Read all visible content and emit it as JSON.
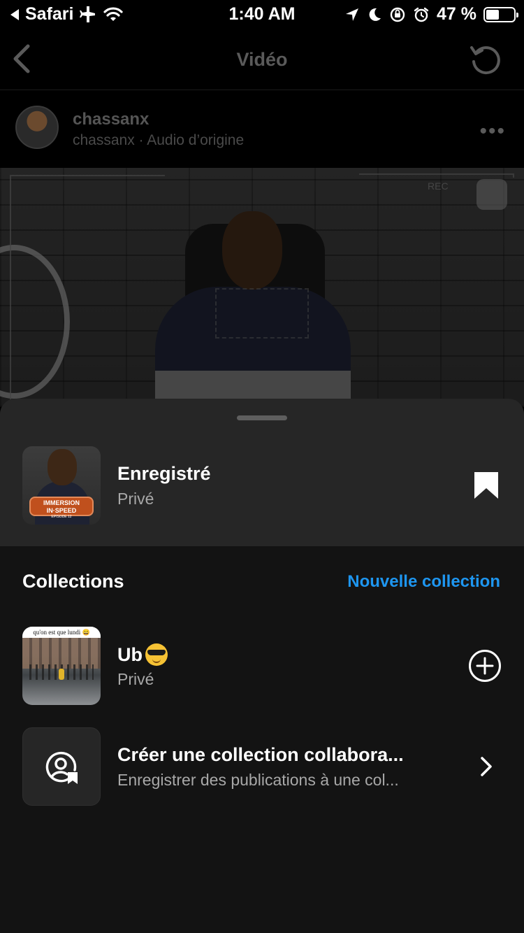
{
  "status_bar": {
    "back_app": "Safari",
    "time": "1:40 AM",
    "battery_percent": "47 %",
    "battery_level": 0.47
  },
  "background_page": {
    "title": "Vidéo",
    "author": {
      "name": "chassanx",
      "subtitle": "chassanx · Audio d’origine"
    },
    "video_overlay": {
      "rec": "REC"
    }
  },
  "sheet": {
    "saved": {
      "title": "Enregistré",
      "privacy": "Privé",
      "thumb_banner": "IMMERSION IN·SPEED",
      "thumb_episode": "EPISODE 12"
    },
    "collections": {
      "header": "Collections",
      "new_label": "Nouvelle collection",
      "items": [
        {
          "title": "Ub",
          "emoji": "cool-sunglasses",
          "privacy": "Privé",
          "thumb_caption": "qu'on est que lundi 😄"
        }
      ]
    },
    "collaborative": {
      "title": "Créer une collection collabora...",
      "subtitle": "Enregistrer des publications à une col..."
    }
  },
  "colors": {
    "sheet_bg": "#131313",
    "sheet_top_bg": "#262626",
    "accent": "#1e96f0",
    "secondary_text": "#a8a8a8"
  },
  "icons": {
    "status": [
      "back-arrow-icon",
      "airplane-icon",
      "wifi-icon",
      "location-icon",
      "moon-icon",
      "rotation-lock-icon",
      "alarm-icon",
      "battery-icon"
    ],
    "nav": [
      "chevron-left-icon",
      "refresh-icon"
    ],
    "sheet": [
      "bookmark-icon",
      "plus-circle-icon",
      "collab-collection-icon",
      "chevron-right-icon"
    ]
  }
}
